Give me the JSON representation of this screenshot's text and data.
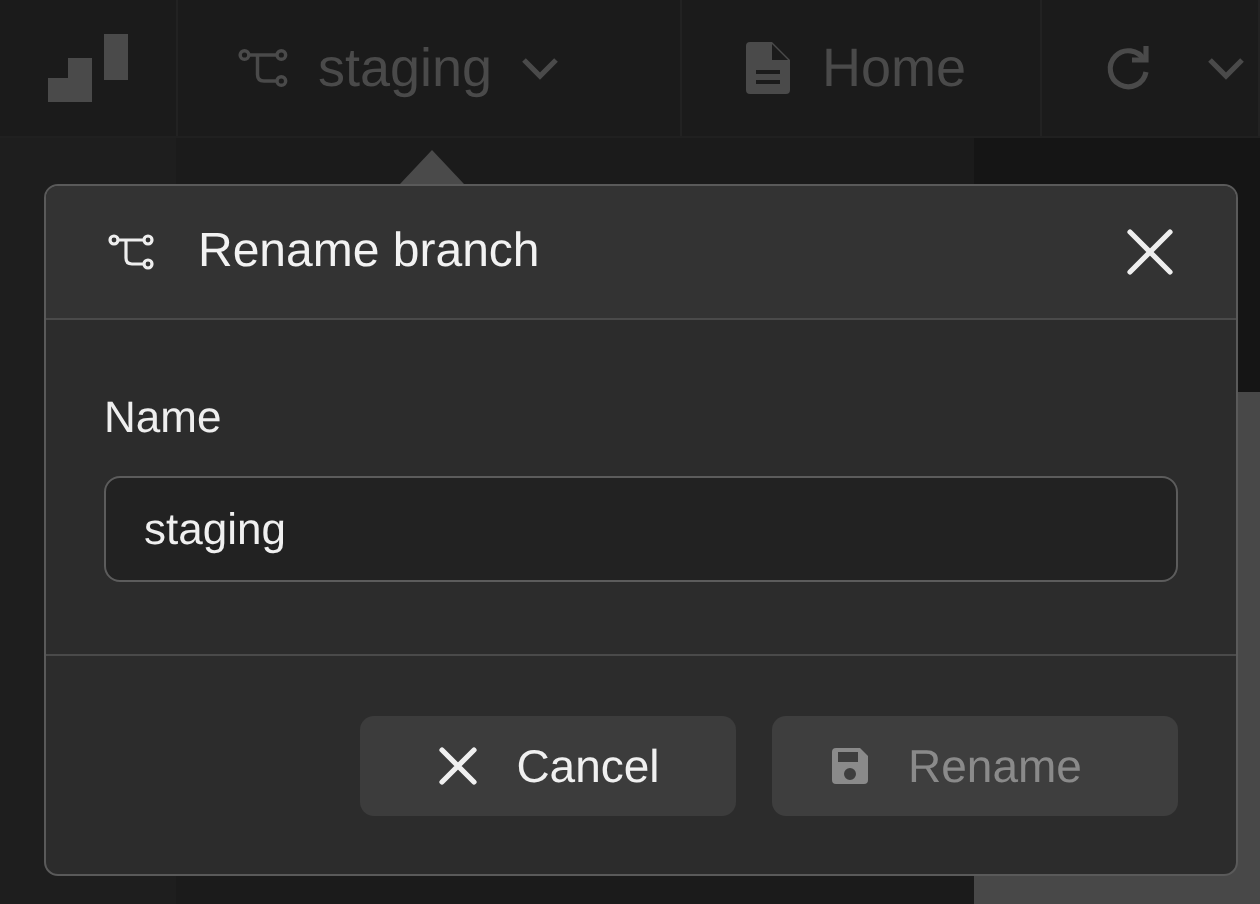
{
  "toolbar": {
    "branch": "staging",
    "page": "Home"
  },
  "dialog": {
    "title": "Rename branch",
    "field": {
      "label": "Name",
      "value": "staging"
    },
    "buttons": [
      {
        "label": "Cancel",
        "kind": "cancel",
        "disabled": false
      },
      {
        "label": "Rename",
        "kind": "save",
        "disabled": true
      }
    ]
  }
}
